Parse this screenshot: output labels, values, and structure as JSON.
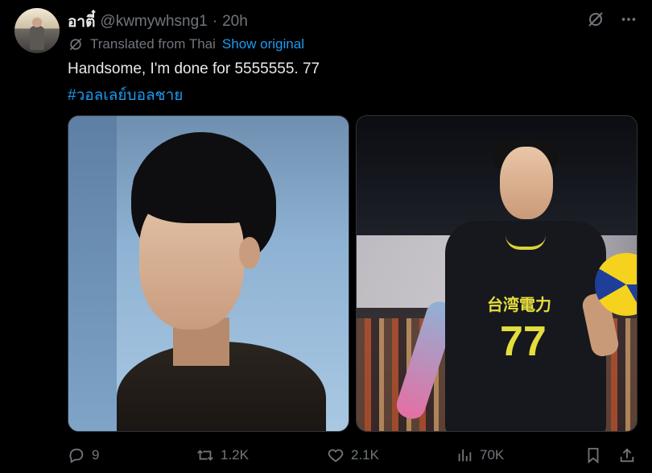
{
  "tweet": {
    "display_name": "อาตี๋",
    "handle": "@kwmywhsng1",
    "separator": "·",
    "time": "20h",
    "translated_label": "Translated from Thai",
    "show_original": "Show original",
    "text": "Handsome, I'm done for 5555555. 77",
    "hashtag": "#วอลเลย์บอลชาย"
  },
  "media": {
    "right_photo": {
      "jersey_text": "台湾電力",
      "jersey_number": "77"
    }
  },
  "actions": {
    "replies": "9",
    "retweets": "1.2K",
    "likes": "2.1K",
    "views": "70K"
  },
  "icons": {
    "grok": "grok-icon",
    "more": "more-icon",
    "translate": "translate-icon",
    "reply": "reply-icon",
    "retweet": "retweet-icon",
    "like": "heart-icon",
    "views": "views-icon",
    "bookmark": "bookmark-icon",
    "share": "share-icon"
  },
  "colors": {
    "background": "#000000",
    "text": "#e7e9ea",
    "muted": "#71767b",
    "link": "#1d9bf0"
  }
}
